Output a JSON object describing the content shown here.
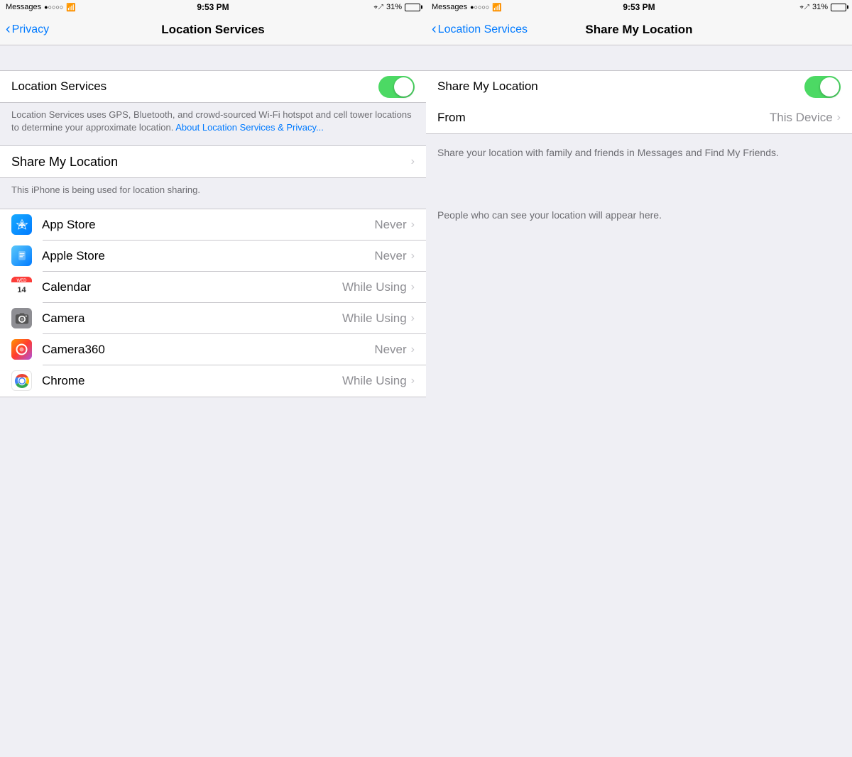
{
  "left_panel": {
    "status_bar": {
      "carrier": "Messages",
      "signal": "●○○○○",
      "wifi": "WiFi",
      "time": "9:53 PM",
      "location_icon": "⊕",
      "battery": "31%"
    },
    "nav_bar": {
      "back_label": "Privacy",
      "title": "Location Services"
    },
    "location_services": {
      "label": "Location Services",
      "description": "Location Services uses GPS, Bluetooth, and crowd-sourced Wi-Fi hotspot and cell tower locations to determine your approximate location.",
      "link_text": "About Location Services & Privacy..."
    },
    "share_my_location": {
      "label": "Share My Location",
      "footer": "This iPhone is being used for location sharing."
    },
    "apps": [
      {
        "name": "App Store",
        "permission": "Never",
        "icon": "appstore"
      },
      {
        "name": "Apple Store",
        "permission": "Never",
        "icon": "applestore"
      },
      {
        "name": "Calendar",
        "permission": "While Using",
        "icon": "calendar"
      },
      {
        "name": "Camera",
        "permission": "While Using",
        "icon": "camera"
      },
      {
        "name": "Camera360",
        "permission": "Never",
        "icon": "camera360"
      },
      {
        "name": "Chrome",
        "permission": "While Using",
        "icon": "chrome"
      }
    ]
  },
  "right_panel": {
    "status_bar": {
      "carrier": "Messages",
      "signal": "●○○○○",
      "wifi": "WiFi",
      "time": "9:53 PM",
      "location_icon": "⊕",
      "battery": "31%"
    },
    "nav_bar": {
      "back_label": "Location Services",
      "title": "Share My Location"
    },
    "share_my_location": {
      "label": "Share My Location"
    },
    "from_row": {
      "label": "From",
      "value": "This Device"
    },
    "description": "Share your location with family and friends in Messages and Find My Friends.",
    "empty_message": "People who can see your location will appear here."
  },
  "colors": {
    "toggle_on": "#4cd964",
    "accent": "#007aff",
    "separator": "#c8c7cc",
    "text_primary": "#000000",
    "text_secondary": "#8e8e93",
    "background": "#efeff4",
    "white": "#ffffff"
  }
}
